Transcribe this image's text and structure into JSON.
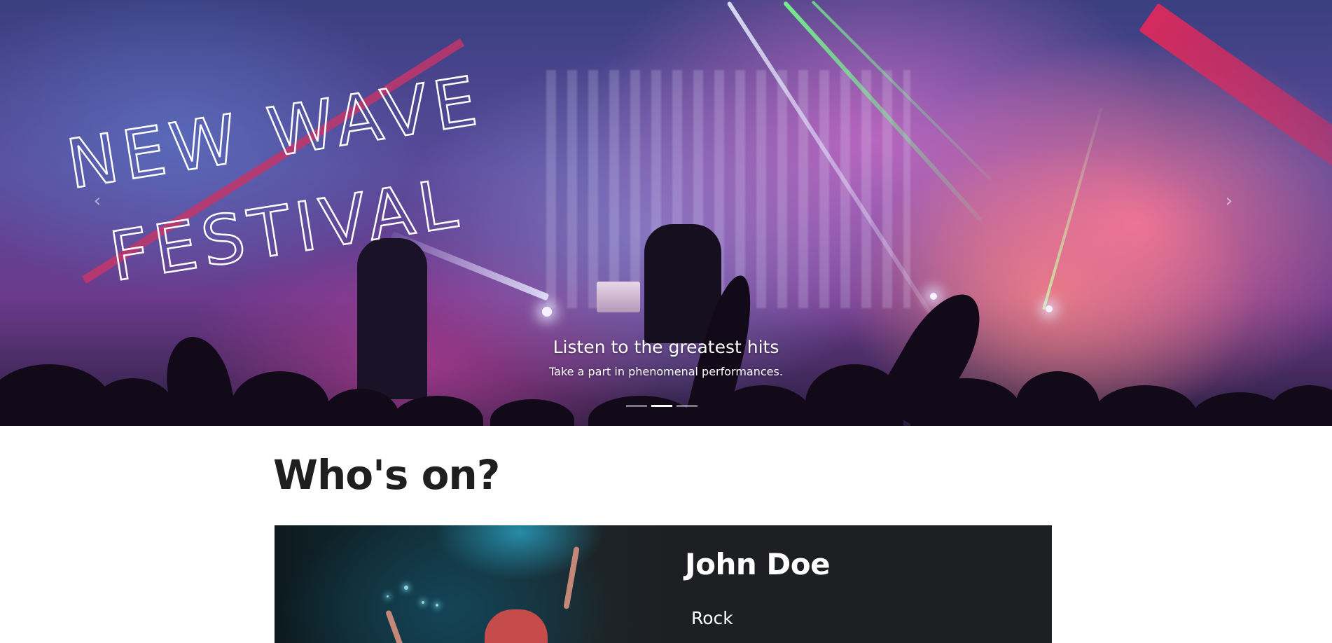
{
  "hero": {
    "logo_line_1": "NEW WAVE",
    "logo_line_2": "FESTIVAL",
    "caption_title": "Listen to the greatest hits",
    "caption_text": "Take a part in phenomenal performances.",
    "prev_icon": "chevron-left-icon",
    "next_icon": "chevron-right-icon",
    "prev_glyph": "‹",
    "next_glyph": "›",
    "slides_total": 3,
    "active_slide": 2,
    "accent_color": "#c2366b"
  },
  "main": {
    "section_title": "Who's on?",
    "artist": {
      "name": "John Doe",
      "genre": "Rock"
    }
  },
  "colors": {
    "card_background": "#1e1f22",
    "title_text": "#1f1f1f"
  }
}
